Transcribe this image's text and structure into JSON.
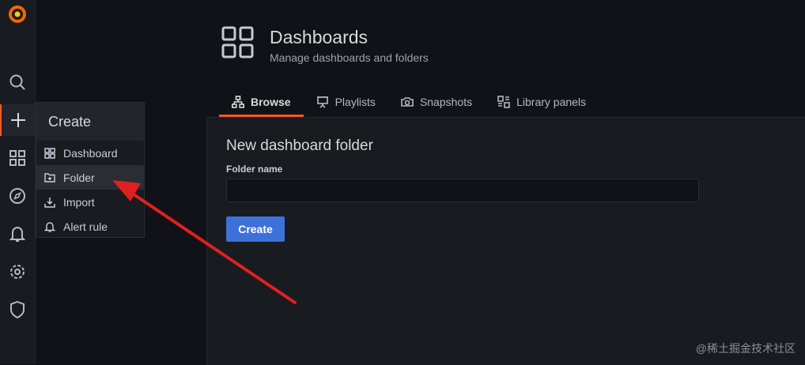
{
  "header": {
    "title": "Dashboards",
    "subtitle": "Manage dashboards and folders"
  },
  "tabs": [
    {
      "label": "Browse",
      "icon": "sitemap-icon",
      "active": true
    },
    {
      "label": "Playlists",
      "icon": "presentation-icon"
    },
    {
      "label": "Snapshots",
      "icon": "camera-icon"
    },
    {
      "label": "Library panels",
      "icon": "library-panel-icon"
    }
  ],
  "form": {
    "title": "New dashboard folder",
    "folder_label": "Folder name",
    "folder_value": "",
    "create_label": "Create"
  },
  "create_menu": {
    "title": "Create",
    "items": [
      {
        "label": "Dashboard",
        "icon": "grid-icon"
      },
      {
        "label": "Folder",
        "icon": "folder-plus-icon",
        "hover": true
      },
      {
        "label": "Import",
        "icon": "import-icon"
      },
      {
        "label": "Alert rule",
        "icon": "bell-icon"
      }
    ]
  },
  "sidebar": {
    "icons": [
      "grafana-logo",
      "search-icon",
      "plus-icon",
      "apps-icon",
      "compass-icon",
      "bell-icon",
      "cog-icon",
      "shield-icon"
    ]
  },
  "watermark": "@稀土掘金技术社区",
  "colors": {
    "accent": "#f05a28",
    "primary_button": "#3d71d9",
    "annotation_arrow": "#e02020"
  }
}
